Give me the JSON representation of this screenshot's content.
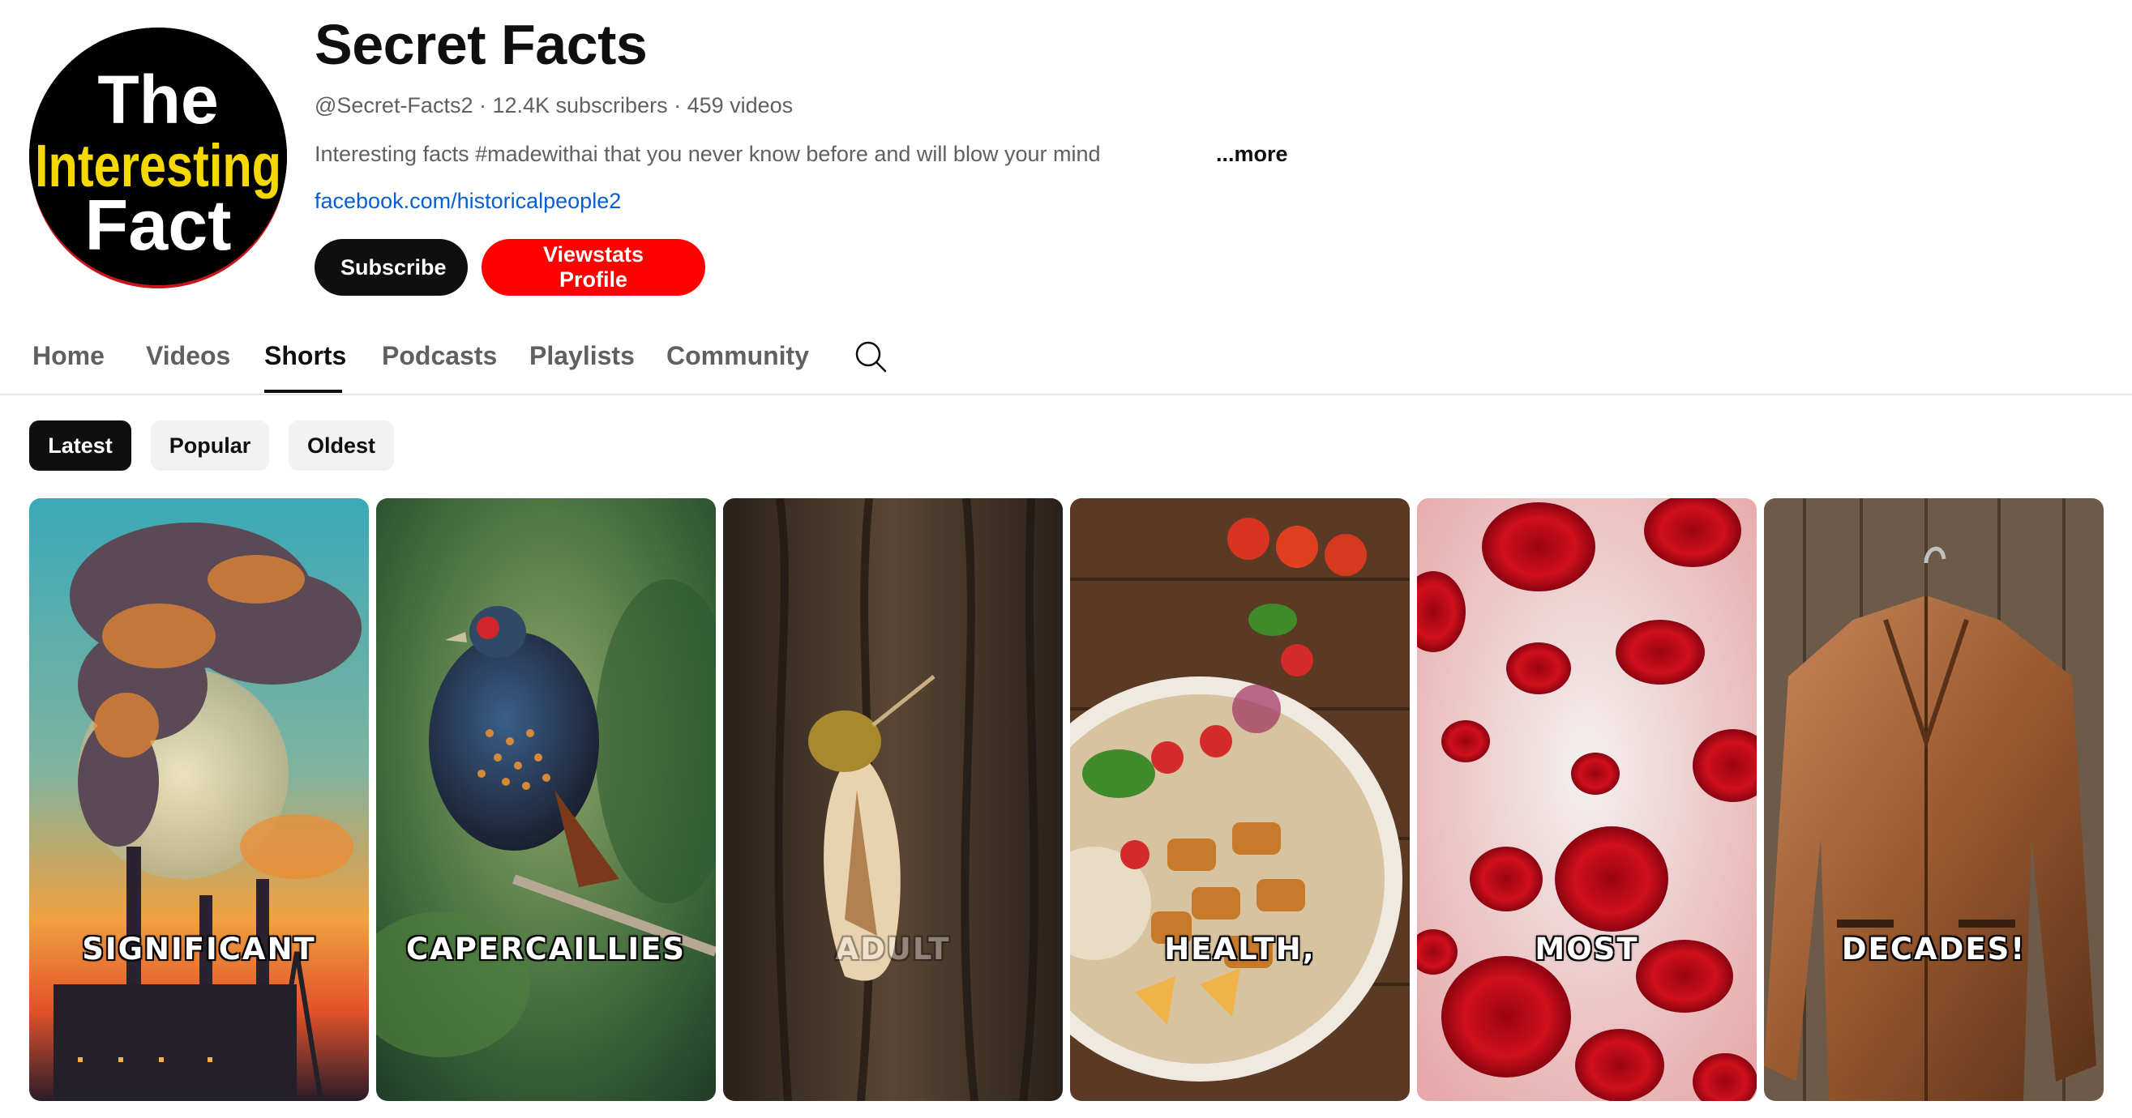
{
  "channel": {
    "name": "Secret Facts",
    "handle": "@Secret-Facts2",
    "separator": " · ",
    "subscribers": "12.4K subscribers",
    "videos": "459 videos",
    "description": "Interesting facts #madewithai that you never know before and will blow  your mind",
    "more_label": "...more",
    "link": "facebook.com/historicalpeople2",
    "avatar": {
      "line1": "The",
      "line2": "Interesting",
      "line3": "Fact",
      "colors": {
        "background": "#000000",
        "primary_text": "#ffffff",
        "accent_text": "#f5d800",
        "ring": "#c4161c"
      }
    }
  },
  "buttons": {
    "subscribe": "Subscribe",
    "viewstats": "Viewstats Profile"
  },
  "tabs": [
    {
      "label": "Home",
      "active": false
    },
    {
      "label": "Videos",
      "active": false
    },
    {
      "label": "Shorts",
      "active": true
    },
    {
      "label": "Podcasts",
      "active": false
    },
    {
      "label": "Playlists",
      "active": false
    },
    {
      "label": "Community",
      "active": false
    }
  ],
  "search_icon": "search-icon",
  "filters": [
    {
      "label": "Latest",
      "active": true
    },
    {
      "label": "Popular",
      "active": false
    },
    {
      "label": "Oldest",
      "active": false
    }
  ],
  "shorts": [
    {
      "caption": "SIGNIFICANT",
      "theme": "factory-smoke-moon"
    },
    {
      "caption": "CAPERCAILLIES",
      "theme": "bird-forest"
    },
    {
      "caption": "ADULT",
      "theme": "moth-bark"
    },
    {
      "caption": "HEALTH,",
      "theme": "food-plate"
    },
    {
      "caption": "MOST",
      "theme": "blood-cells"
    },
    {
      "caption": "DECADES!",
      "theme": "leather-jacket"
    }
  ],
  "colors": {
    "accent_red": "#ff0000",
    "link_blue": "#065fd4",
    "text_primary": "#0f0f0f",
    "text_secondary": "#606060"
  }
}
